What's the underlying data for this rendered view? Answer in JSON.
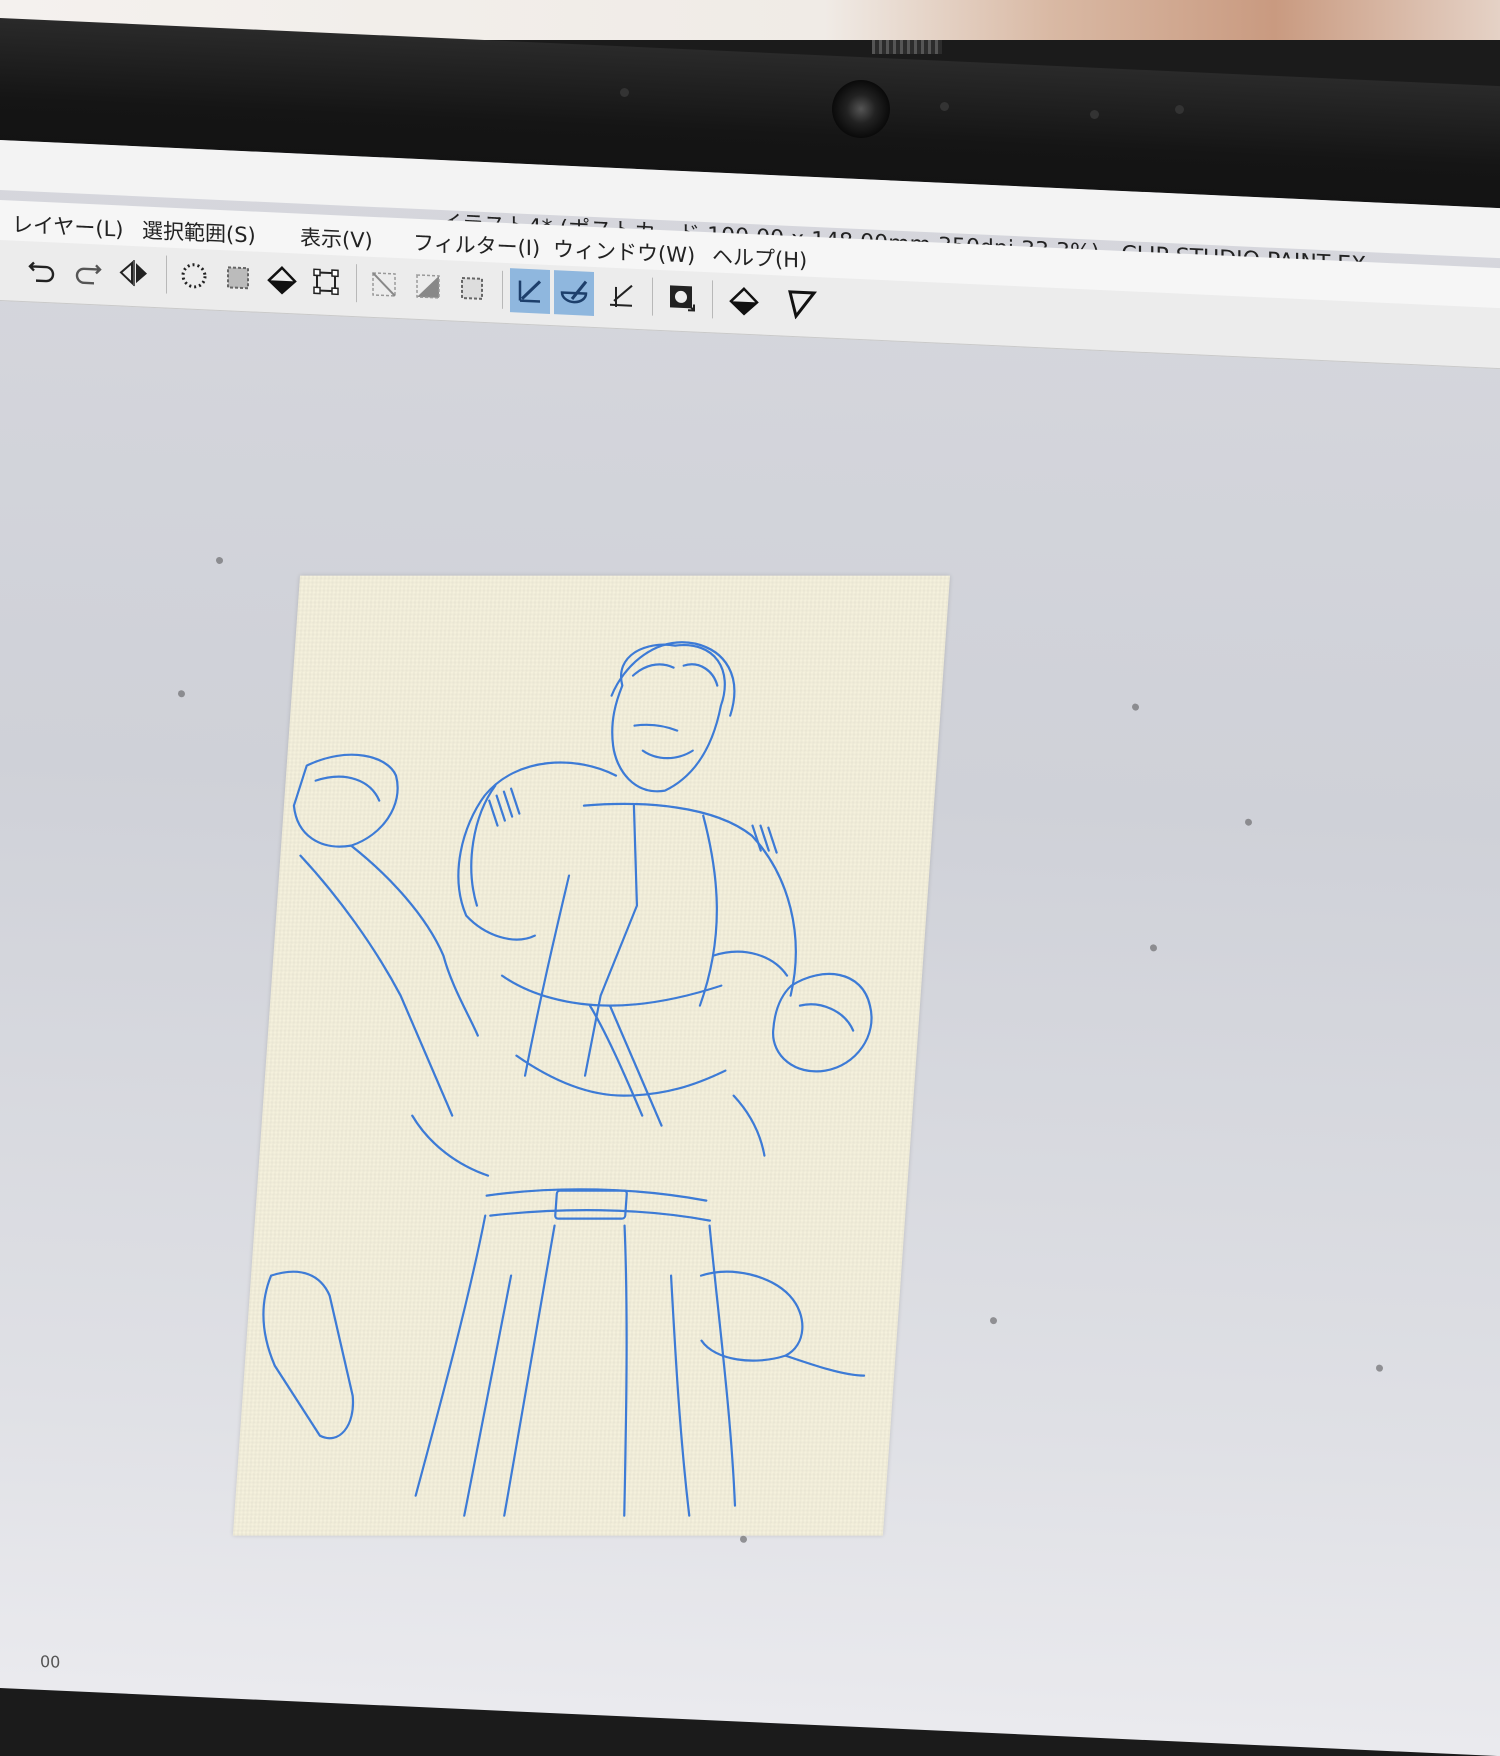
{
  "window": {
    "title": "イラスト4* (ポストカード 100.00 x 148.00mm 350dpi 33.3%)  - CLIP STUDIO PAINT EX"
  },
  "menu": {
    "items": [
      {
        "label": "レイヤー(L)"
      },
      {
        "label": "選択範囲(S)"
      },
      {
        "label": "表示(V)"
      },
      {
        "label": "フィルター(I)"
      },
      {
        "label": "ウィンドウ(W)"
      },
      {
        "label": "ヘルプ(H)"
      }
    ]
  },
  "toolbar": {
    "tools": [
      {
        "icon": "undo-icon"
      },
      {
        "icon": "redo-icon"
      },
      {
        "icon": "flip-horizontal-icon"
      },
      {
        "icon": "select-all-icon"
      },
      {
        "icon": "deselect-icon"
      },
      {
        "icon": "fill-icon"
      },
      {
        "icon": "transform-icon"
      },
      {
        "icon": "clear-outside-selection-icon"
      },
      {
        "icon": "clear-selection-icon"
      },
      {
        "icon": "selection-frame-icon"
      },
      {
        "icon": "ruler-icon",
        "active": true
      },
      {
        "icon": "curve-ruler-icon",
        "active": true
      },
      {
        "icon": "perspective-ruler-icon"
      },
      {
        "icon": "layer-mask-icon"
      },
      {
        "icon": "fill-selection-icon"
      },
      {
        "icon": "triangle-tool-icon"
      }
    ]
  },
  "status": {
    "zoom": "00"
  },
  "colors": {
    "sketch_stroke": "#2a6fd6",
    "paper": "#f5f1dd",
    "canvas_bg": "#d3d4da",
    "active_tool": "#8fb7de"
  }
}
